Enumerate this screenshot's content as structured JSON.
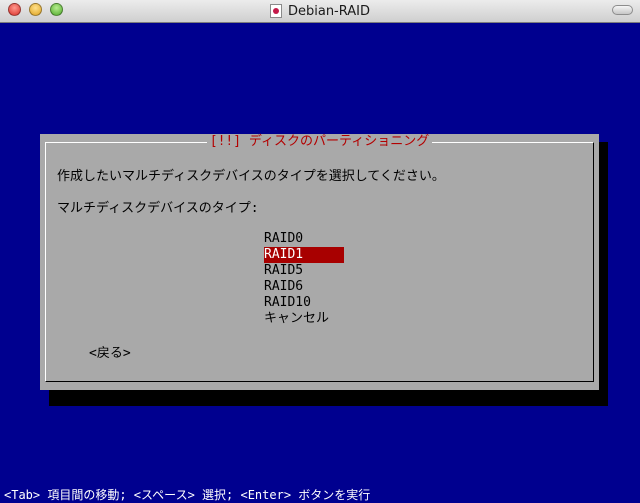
{
  "window": {
    "title": "Debian-RAID"
  },
  "dialog": {
    "title": "[!!] ディスクのパーティショニング",
    "prompt": "作成したいマルチディスクデバイスのタイプを選択してください。",
    "list_label": "マルチディスクデバイスのタイプ:",
    "options": [
      {
        "label": "RAID0",
        "selected": false
      },
      {
        "label": "RAID1",
        "selected": true
      },
      {
        "label": "RAID5",
        "selected": false
      },
      {
        "label": "RAID6",
        "selected": false
      },
      {
        "label": "RAID10",
        "selected": false
      },
      {
        "label": "キャンセル",
        "selected": false
      }
    ],
    "back_label": "<戻る>"
  },
  "footer": {
    "hint": "<Tab> 項目間の移動; <スペース> 選択; <Enter> ボタンを実行"
  },
  "colors": {
    "background": "#00008f",
    "dialog": "#a9a9a9",
    "title_text": "#b30000",
    "selection": "#a80000"
  },
  "icons": {
    "close": "close-traffic-light",
    "minimize": "minimize-traffic-light",
    "zoom": "zoom-traffic-light",
    "document": "document-proxy-icon"
  }
}
